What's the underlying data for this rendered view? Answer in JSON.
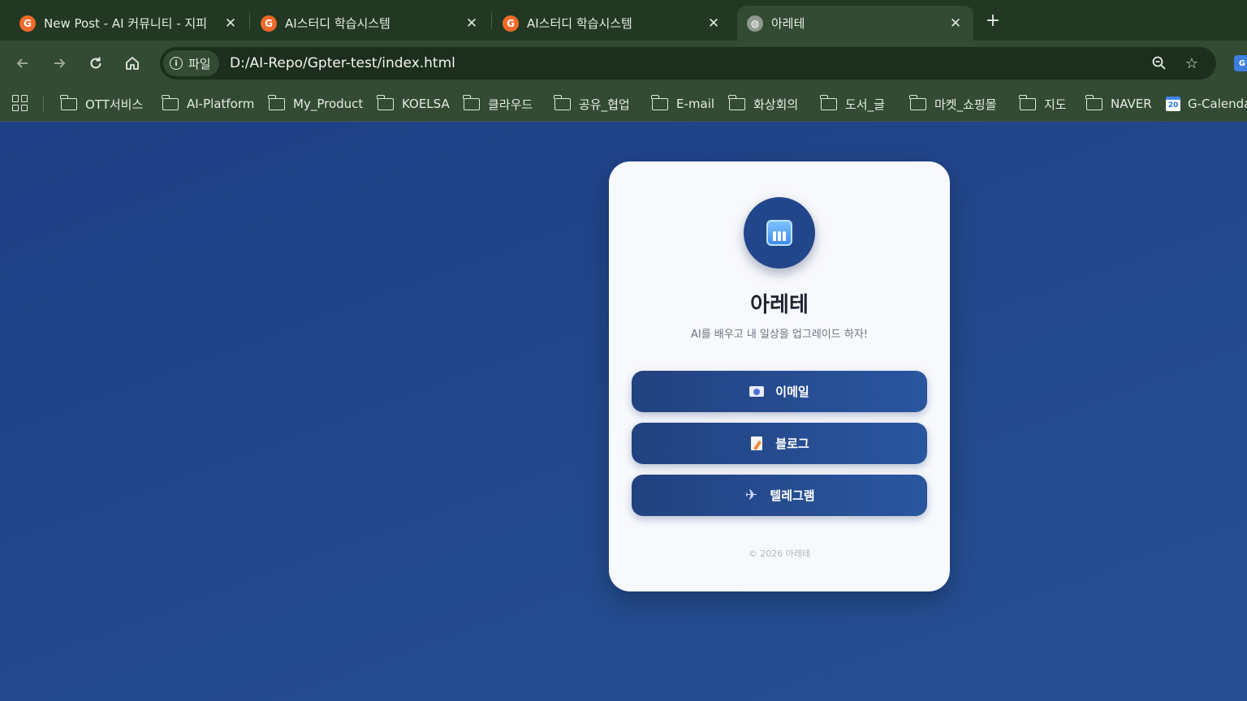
{
  "browser": {
    "tabs": [
      {
        "title": "New Post - AI 커뮤니티 - 지피",
        "favicon": "G"
      },
      {
        "title": "AI스터디 학습시스템",
        "favicon": "G"
      },
      {
        "title": "AI스터디 학습시스템",
        "favicon": "G"
      },
      {
        "title": "아레테",
        "favicon": "globe"
      }
    ],
    "address": {
      "chip_label": "파일",
      "url": "D:/AI-Repo/Gpter-test/index.html"
    },
    "bookmarks": [
      "OTT서비스",
      "AI-Platform",
      "My_Product",
      "KOELSA",
      "클라우드",
      "공유_협업",
      "E-mail",
      "화상회의",
      "도서_글",
      "마켓_쇼핑몰",
      "지도",
      "NAVER",
      "G-Calendar"
    ],
    "calendar_badge": "20"
  },
  "page": {
    "title": "아레테",
    "subtitle": "AI를 배우고 내 일상을 업그레이드 하자!",
    "buttons": [
      {
        "label": "이메일",
        "icon": "email-icon"
      },
      {
        "label": "블로그",
        "icon": "blog-icon"
      },
      {
        "label": "텔레그램",
        "icon": "plane-icon"
      }
    ],
    "footer": "© 2026 아레테"
  },
  "colors": {
    "background": "#22468a",
    "card": "#f8f9fc",
    "button": "#2a56a0",
    "chrome": "#324b32"
  }
}
